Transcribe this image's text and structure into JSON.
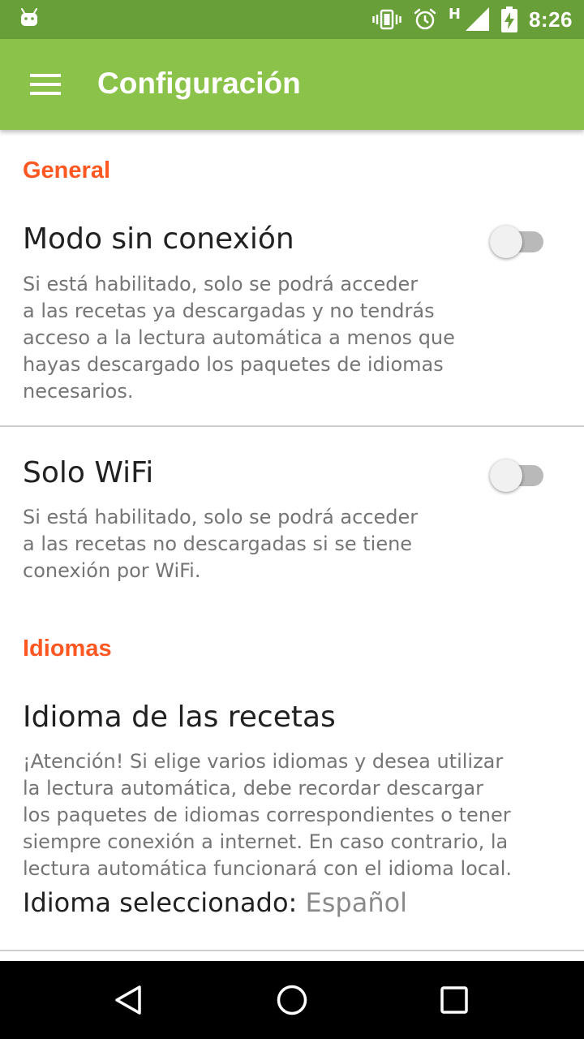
{
  "status_bar": {
    "time": "8:26",
    "network_type": "H",
    "icons": [
      "android-notification-icon",
      "vibrate-icon",
      "alarm-icon",
      "signal-icon",
      "battery-charging-icon"
    ]
  },
  "toolbar": {
    "title": "Configuración",
    "menu_icon": "hamburger-menu-icon"
  },
  "sections": {
    "general": {
      "header": "General",
      "offline": {
        "title": "Modo sin conexión",
        "summary_lines": [
          "Si está habilitado, solo se podrá acceder",
          "a las recetas ya descargadas y no tendrás",
          "acceso a la lectura automática a menos que",
          "hayas descargado los paquetes de idiomas",
          "necesarios."
        ],
        "enabled": false
      },
      "wifi": {
        "title": "Solo WiFi",
        "summary_lines": [
          "Si está habilitado, solo se podrá acceder",
          "a las recetas no descargadas si se tiene",
          "conexión por WiFi."
        ],
        "enabled": false
      }
    },
    "languages": {
      "header": "Idiomas",
      "recipe_language": {
        "title": "Idioma de las recetas",
        "summary_lines": [
          "¡Atención! Si elige varios idiomas y desea utilizar",
          "la lectura automática, debe recordar descargar",
          "los paquetes de idiomas correspondientes o tener",
          "siempre conexión a internet. En caso contrario, la",
          "lectura automática funcionará con el idioma local."
        ],
        "selected_label": "Idioma seleccionado:",
        "selected_value": "Español"
      }
    }
  },
  "nav_bar": {
    "icons": [
      "back-icon",
      "home-icon",
      "recents-icon"
    ]
  },
  "colors": {
    "status_bar": "#689F38",
    "toolbar": "#8BC34A",
    "section_header": "#FF5722"
  }
}
